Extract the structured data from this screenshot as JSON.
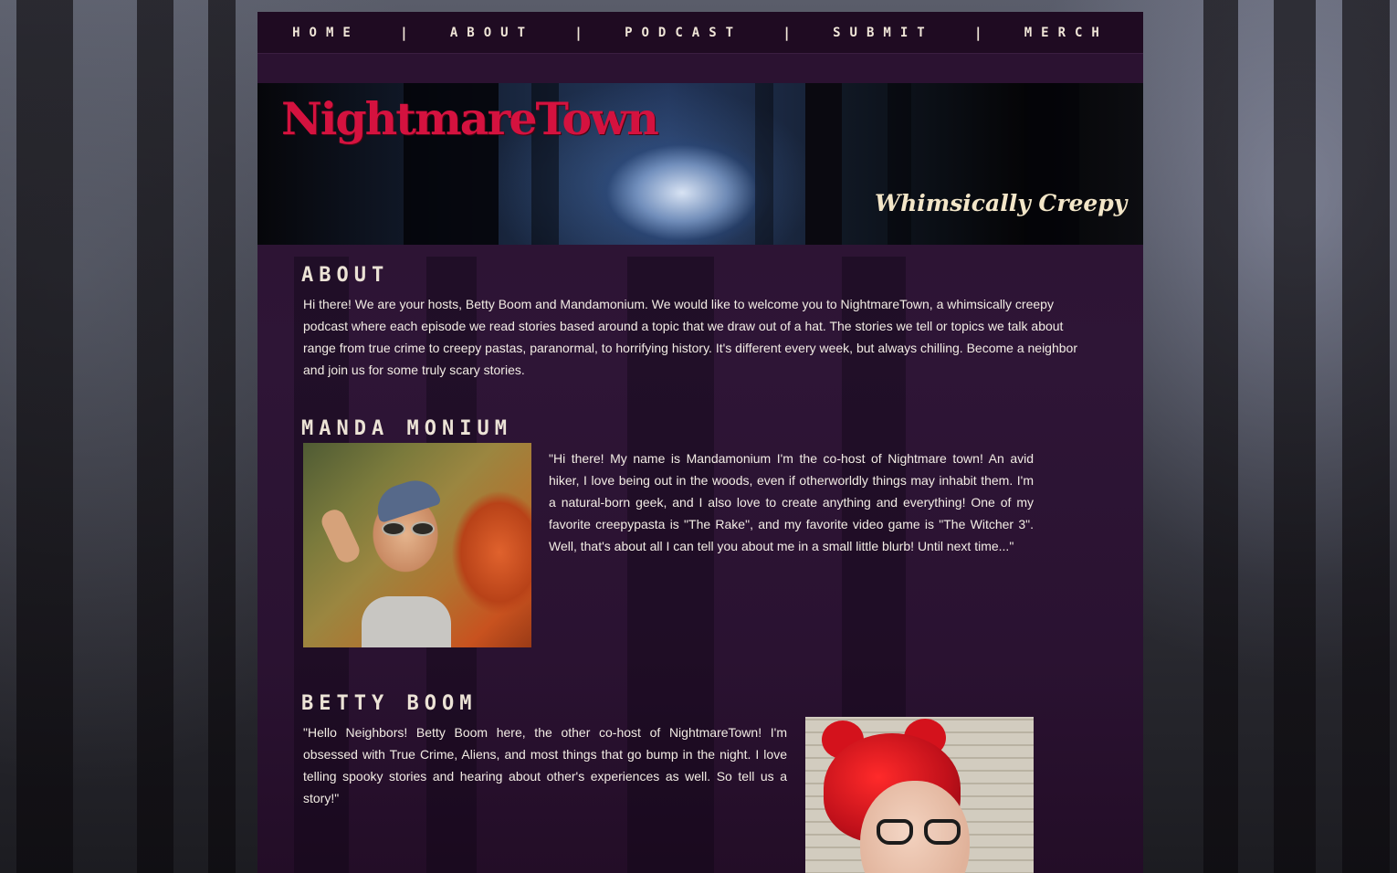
{
  "nav": {
    "items": [
      {
        "label": "HOME"
      },
      {
        "label": "ABOUT"
      },
      {
        "label": "PODCAST"
      },
      {
        "label": "SUBMIT"
      },
      {
        "label": "MERCH"
      }
    ],
    "separator": "|"
  },
  "banner": {
    "logo": "NightmareTown",
    "tagline": "Whimsically Creepy"
  },
  "about": {
    "heading": "ABOUT",
    "text": "Hi there! We are your hosts, Betty Boom and Mandamonium. We would like to welcome you to NightmareTown, a whimsically creepy podcast where each episode we read stories based around a topic that we draw out of a hat. The stories we tell or topics we talk about range from true crime to creepy pastas, paranormal, to horrifying history. It's different every week, but always chilling. Become a neighbor and join us for some truly scary stories."
  },
  "manda": {
    "heading": "MANDA MONIUM",
    "text": "\"Hi there! My name is Mandamonium I'm the co-host of Nightmare town! An avid hiker, I love being out in the woods, even if otherworldly things may inhabit them. I'm a natural-born geek, and I also love to create anything and everything! One of my favorite creepypasta is \"The Rake\", and my favorite video game is \"The Witcher 3\". Well, that's about all I can tell you about me in a small little blurb! Until next time...\""
  },
  "betty": {
    "heading": "BETTY BOOM",
    "text": "\"Hello Neighbors! Betty Boom here, the other co-host of NightmareTown! I'm obsessed with True Crime, Aliens, and most things that go bump in the night. I love telling spooky stories and hearing about other's experiences as well. So tell us a story!\""
  },
  "colors": {
    "logo": "#d4123f",
    "text": "#f2ece4",
    "panel": "#2e1536",
    "nav": "#1f0b22"
  }
}
